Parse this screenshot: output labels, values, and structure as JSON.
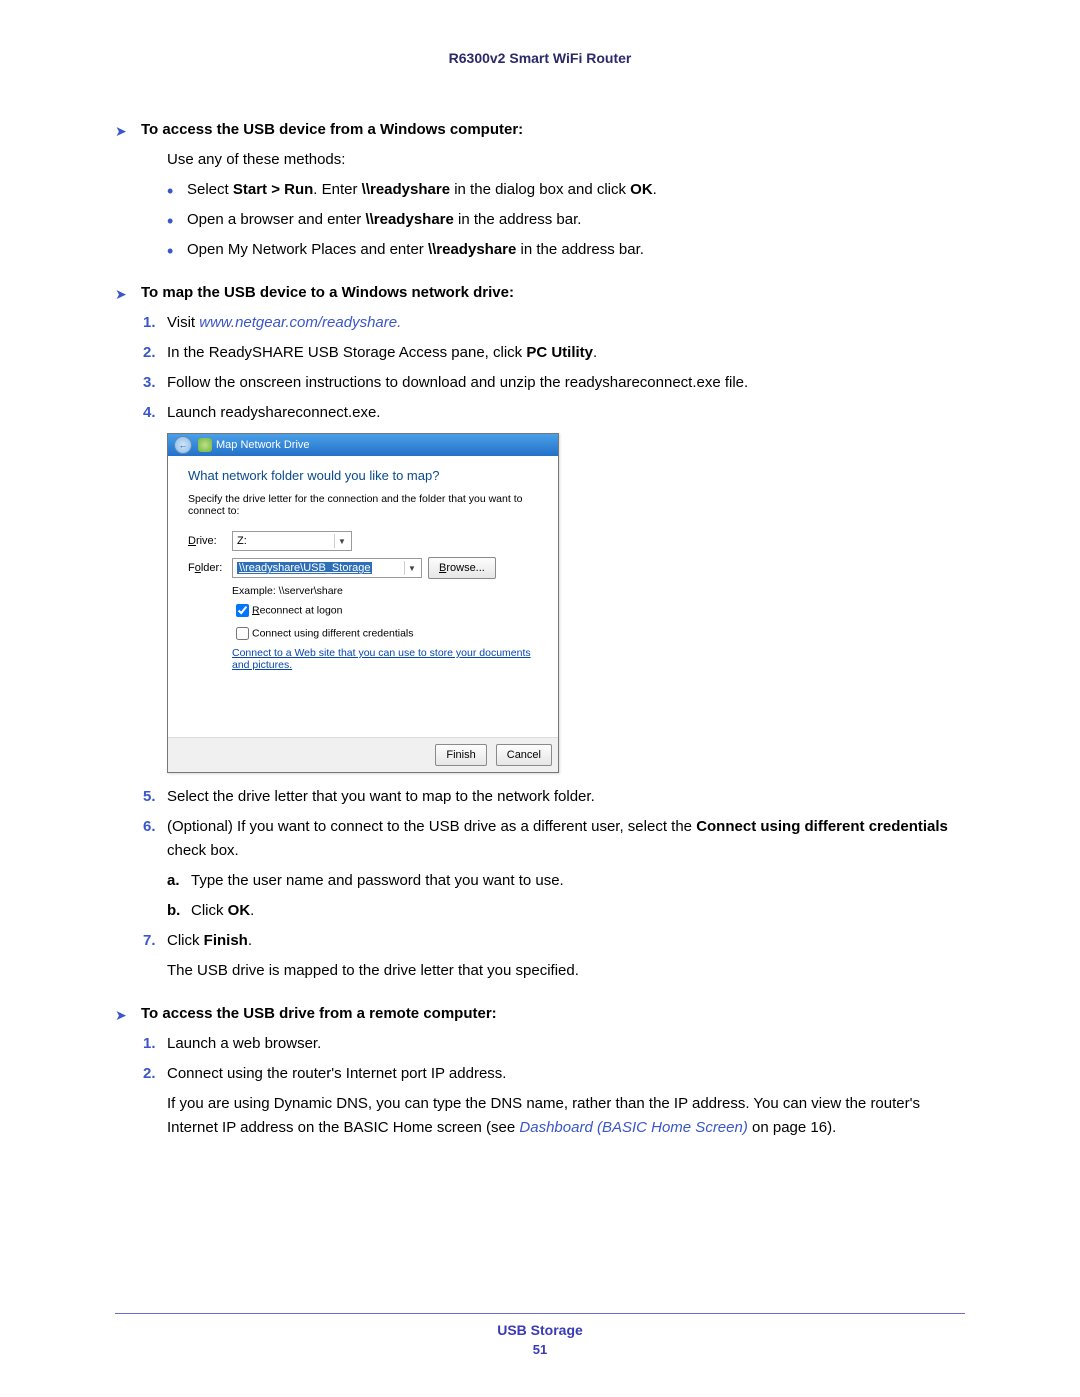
{
  "header": {
    "product": "R6300v2 Smart WiFi Router"
  },
  "proc1": {
    "title": "To access the USB device from a Windows computer:",
    "intro": "Use any of these methods:",
    "b1_a": "Select ",
    "b1_b": "Start > Run",
    "b1_c": ". Enter ",
    "b1_d": "\\\\readyshare",
    "b1_e": " in the dialog box and click ",
    "b1_f": "OK",
    "b1_g": ".",
    "b2_a": "Open a browser and enter ",
    "b2_b": "\\\\readyshare",
    "b2_c": " in the address bar.",
    "b3_a": "Open My Network Places and enter ",
    "b3_b": "\\\\readyshare",
    "b3_c": " in the address bar."
  },
  "proc2": {
    "title": "To map the USB device to a Windows network drive:",
    "s1_a": "Visit ",
    "s1_link": "www.netgear.com/readyshare.",
    "s2_a": "In the ReadySHARE USB Storage Access pane, click ",
    "s2_b": "PC Utility",
    "s2_c": ".",
    "s3": "Follow the onscreen instructions to download and unzip the readyshareconnect.exe file.",
    "s4": "Launch readyshareconnect.exe.",
    "s5": "Select the drive letter that you want to map to the network folder.",
    "s6_a": "(Optional) If you want to connect to the USB drive as a different user, select the ",
    "s6_b": "Connect using different credentials",
    "s6_c": " check box.",
    "s6a": "Type the user name and password that you want to use.",
    "s6b_a": "Click ",
    "s6b_b": "OK",
    "s6b_c": ".",
    "s7_a": "Click ",
    "s7_b": "Finish",
    "s7_c": ".",
    "s7_after": "The USB drive is mapped to the drive letter that you specified."
  },
  "dialog": {
    "title": "Map Network Drive",
    "question": "What network folder would you like to map?",
    "desc": "Specify the drive letter for the connection and the folder that you want to connect to:",
    "drive_label": "Drive:",
    "drive_value": "Z:",
    "folder_label": "Folder:",
    "folder_value": "\\\\readyshare\\USB_Storage",
    "browse": "Browse...",
    "example": "Example: \\\\server\\share",
    "cb1": "Reconnect at logon",
    "cb2": "Connect using different credentials",
    "link": "Connect to a Web site that you can use to store your documents and pictures.",
    "finish": "Finish",
    "cancel": "Cancel"
  },
  "proc3": {
    "title": "To access the USB drive from a remote computer:",
    "s1": "Launch a web browser.",
    "s2": "Connect using the router's Internet port IP address.",
    "s2_after_a": "If you are using Dynamic DNS, you can type the DNS name, rather than the IP address. You can view the router's Internet IP address on the BASIC Home screen (see ",
    "s2_link": "Dashboard (BASIC Home Screen)",
    "s2_after_b": " on page 16)."
  },
  "footer": {
    "section": "USB Storage",
    "page": "51"
  }
}
